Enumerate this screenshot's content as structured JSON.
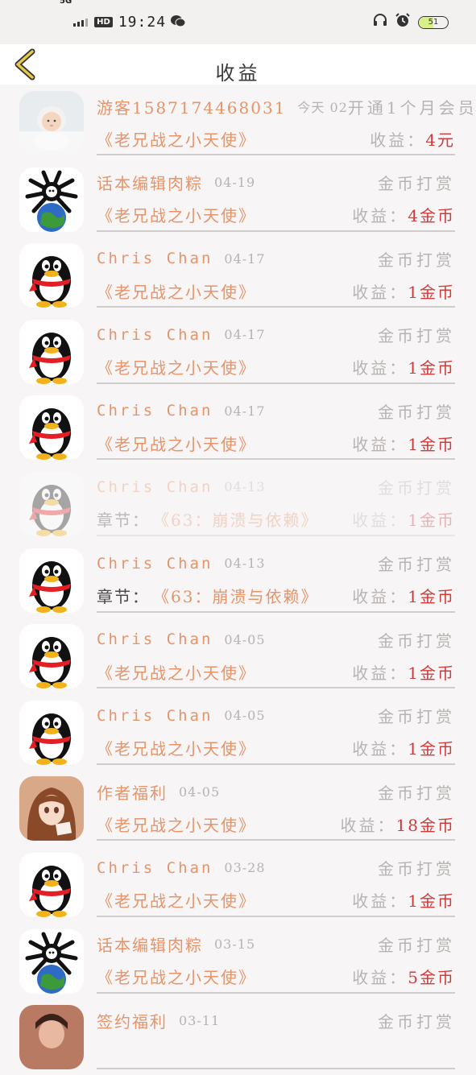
{
  "status_bar": {
    "network": "5G",
    "hd": "HD",
    "time": "19:24",
    "battery": "51",
    "battery_level": 0.51
  },
  "nav": {
    "title": "收益"
  },
  "rows": [
    {
      "avatar": "baby-photo-avatar",
      "name": "游客15871744680​31",
      "date": "今天 02",
      "type": "开通1个月会员",
      "prefix": "",
      "item": "《老兄战之小天使》",
      "earn_label": "收益：",
      "earn_value": "4元"
    },
    {
      "avatar": "octopus-earth-avatar",
      "name": "话本编辑肉粽",
      "date": "04-19",
      "type": "金币打赏",
      "prefix": "",
      "item": "《老兄战之小天使》",
      "earn_label": "收益：",
      "earn_value": "4金币"
    },
    {
      "avatar": "qq-penguin-avatar",
      "name": "Chris Chan",
      "date": "04-17",
      "type": "金币打赏",
      "prefix": "",
      "item": "《老兄战之小天使》",
      "earn_label": "收益：",
      "earn_value": "1金币"
    },
    {
      "avatar": "qq-penguin-avatar",
      "name": "Chris Chan",
      "date": "04-17",
      "type": "金币打赏",
      "prefix": "",
      "item": "《老兄战之小天使》",
      "earn_label": "收益：",
      "earn_value": "1金币"
    },
    {
      "avatar": "qq-penguin-avatar",
      "name": "Chris Chan",
      "date": "04-17",
      "type": "金币打赏",
      "prefix": "",
      "item": "《老兄战之小天使》",
      "earn_label": "收益：",
      "earn_value": "1金币"
    },
    {
      "avatar": "qq-penguin-avatar",
      "name": "Chris Chan",
      "date": "04-13",
      "type": "金币打赏",
      "prefix": "章节：",
      "item": "《63：崩溃与依赖》",
      "earn_label": "收益：",
      "earn_value": "1金币"
    },
    {
      "avatar": "qq-penguin-avatar",
      "name": "Chris Chan",
      "date": "04-13",
      "type": "金币打赏",
      "prefix": "章节：",
      "item": "《63：崩溃与依赖》",
      "earn_label": "收益：",
      "earn_value": "1金币"
    },
    {
      "avatar": "qq-penguin-avatar",
      "name": "Chris Chan",
      "date": "04-05",
      "type": "金币打赏",
      "prefix": "",
      "item": "《老兄战之小天使》",
      "earn_label": "收益：",
      "earn_value": "1金币"
    },
    {
      "avatar": "qq-penguin-avatar",
      "name": "Chris Chan",
      "date": "04-05",
      "type": "金币打赏",
      "prefix": "",
      "item": "《老兄战之小天使》",
      "earn_label": "收益：",
      "earn_value": "1金币"
    },
    {
      "avatar": "anime-girl-avatar",
      "name": "作者福利",
      "date": "04-05",
      "type": "金币打赏",
      "prefix": "",
      "item": "《老兄战之小天使》",
      "earn_label": "收益：",
      "earn_value": "18金币"
    },
    {
      "avatar": "qq-penguin-avatar",
      "name": "Chris Chan",
      "date": "03-28",
      "type": "金币打赏",
      "prefix": "",
      "item": "《老兄战之小天使》",
      "earn_label": "收益：",
      "earn_value": "1金币"
    },
    {
      "avatar": "octopus-earth-avatar",
      "name": "话本编辑肉粽",
      "date": "03-15",
      "type": "金币打赏",
      "prefix": "",
      "item": "《老兄战之小天使》",
      "earn_label": "收益：",
      "earn_value": "5金币"
    },
    {
      "avatar": "portrait-avatar",
      "name": "签约福利",
      "date": "03-11",
      "type": "金币打赏",
      "prefix": "",
      "item": "",
      "earn_label": "",
      "earn_value": ""
    }
  ],
  "colors": {
    "name": "#e6946a",
    "muted": "#b8b3b3",
    "value": "#d03a3a",
    "accent_back": "#e8c84a"
  }
}
